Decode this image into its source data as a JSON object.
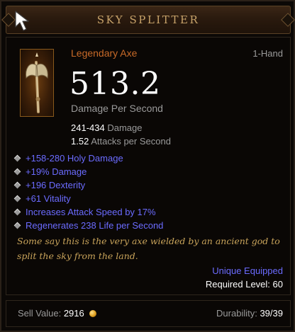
{
  "item": {
    "name": "SKY SPLITTER",
    "type": "Legendary Axe",
    "slot": "1-Hand",
    "dps": "513.2",
    "dps_label": "Damage Per Second",
    "damage_range": "241-434",
    "damage_label": "Damage",
    "attacks_per_second": "1.52",
    "attacks_label": "Attacks per Second",
    "affixes": [
      "+158-280 Holy Damage",
      "+19% Damage",
      "+196 Dexterity",
      "+61 Vitality",
      "Increases Attack Speed by 17%",
      "Regenerates 238 Life per Second"
    ],
    "flavor_text": "Some say this is the very axe wielded by an ancient god to split the sky from the land.",
    "unique_equipped": "Unique Equipped",
    "required_level": "Required Level: 60",
    "sell_value_label": "Sell Value:",
    "sell_value": "2916",
    "durability_label": "Durability:",
    "durability": "39/39"
  },
  "icons": {
    "cursor": "cursor-arrow-icon",
    "item": "axe-icon",
    "affix_bullet": "diamond-bullet-icon",
    "gold": "gold-coin-icon"
  },
  "colors": {
    "legendary": "#c86a28",
    "magic_affix": "#6b6bff",
    "title": "#c8a36a",
    "flavor": "#c8a35a",
    "gray_text": "#9a9a9a"
  }
}
